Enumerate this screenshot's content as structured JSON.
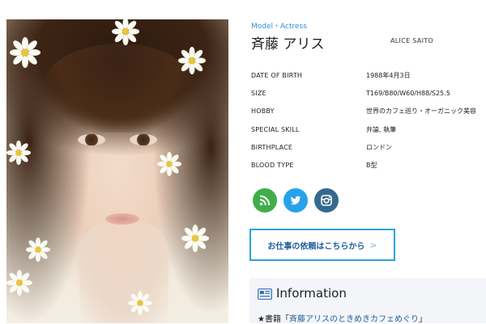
{
  "profile": {
    "category": "Model・Actress",
    "name_ja": "斉藤 アリス",
    "name_en": "ALICE SAITO",
    "rows": [
      {
        "label": "DATE OF BIRTH",
        "value": "1988年4月3日"
      },
      {
        "label": "SIZE",
        "value": "T169/B80/W60/H88/S25.5"
      },
      {
        "label": "HOBBY",
        "value": "世界のカフェ巡り・オーガニック美容"
      },
      {
        "label": "SPECIAL SKILL",
        "value": "弁論, 執筆"
      },
      {
        "label": "BIRTHPLACE",
        "value": "ロンドン"
      },
      {
        "label": "BLOOD TYPE",
        "value": "B型"
      }
    ]
  },
  "social": [
    {
      "icon": "rss-icon",
      "color": "#3fae49"
    },
    {
      "icon": "twitter-icon",
      "color": "#27a2e8"
    },
    {
      "icon": "instagram-icon",
      "color": "#356a8e"
    }
  ],
  "work_button": {
    "label": "お仕事の依頼はこちらから",
    "chevron": ">"
  },
  "information": {
    "title": "Information",
    "item_prefix": "★書籍",
    "item_open": "「",
    "item_link": "斉藤アリスのときめきカフェめぐり",
    "item_close": "」"
  },
  "colors": {
    "accent": "#29a3de",
    "link": "#1d5f9c",
    "category": "#2f8fd4"
  }
}
